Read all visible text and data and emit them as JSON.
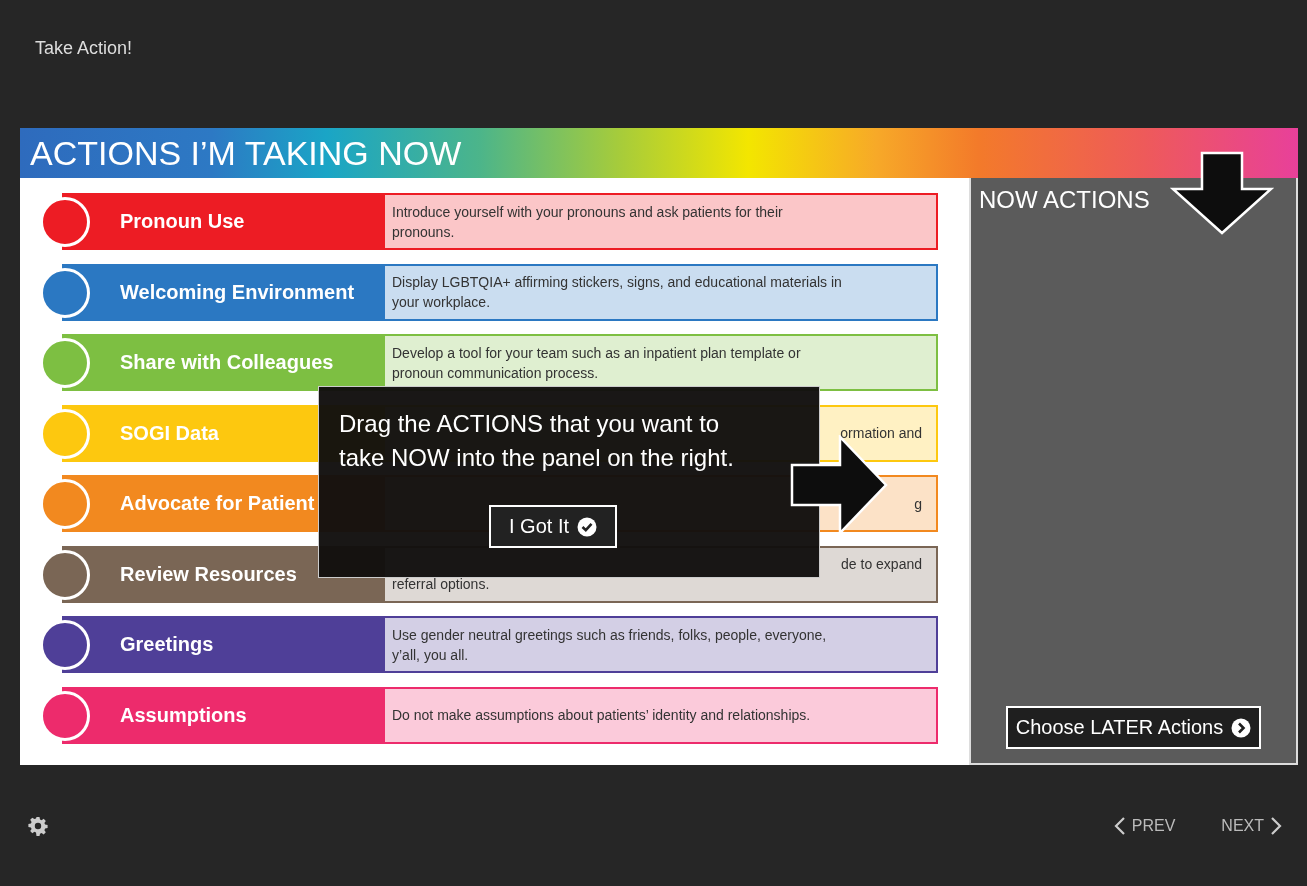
{
  "window": {
    "title": "Take Action!"
  },
  "slide": {
    "title": "ACTIONS I’M TAKING NOW",
    "actions": [
      {
        "label": "Pronoun Use",
        "color": "#ed1c24",
        "description": [
          {
            "text": "Introduce yourself with your pronouns and ask patients for their",
            "kind": "full"
          },
          {
            "text": "pronouns.",
            "kind": "full"
          }
        ]
      },
      {
        "label": "Welcoming Environment",
        "color": "#2b78c2",
        "description": [
          {
            "text": "Display LGBTQIA+ affirming stickers, signs, and educational materials in",
            "kind": "full"
          },
          {
            "text": "your workplace.",
            "kind": "full"
          }
        ]
      },
      {
        "label": "Share with Colleagues",
        "color": "#7dbf42",
        "description": [
          {
            "text": "Develop a tool for your team such as an inpatient plan template or",
            "kind": "full"
          },
          {
            "text": "pronoun communication process.",
            "kind": "full"
          }
        ]
      },
      {
        "label": "SOGI Data",
        "color": "#fdc80f",
        "description": [
          {
            "text": "ormation and",
            "kind": "partial"
          }
        ]
      },
      {
        "label": "Advocate for Patient",
        "color": "#f2891f",
        "description": [
          {
            "text": "g",
            "kind": "partial"
          }
        ]
      },
      {
        "label": "Review Resources",
        "color": "#7a6655",
        "description": [
          {
            "text": "de to expand",
            "kind": "partial"
          },
          {
            "text": "referral options.",
            "kind": "full"
          }
        ]
      },
      {
        "label": "Greetings",
        "color": "#4f3f98",
        "description": [
          {
            "text": "Use gender neutral greetings such as friends, folks, people, everyone,",
            "kind": "full"
          },
          {
            "text": "y’all, you all.",
            "kind": "full"
          }
        ]
      },
      {
        "label": "Assumptions",
        "color": "#ed2b6c",
        "description": [
          {
            "text": "Do not make assumptions about patients’ identity and relationships.",
            "kind": "full"
          }
        ]
      }
    ],
    "panel": {
      "title": "NOW ACTIONS",
      "button": "Choose LATER Actions"
    },
    "overlay": {
      "message": "Drag the ACTIONS that you want to take NOW into the panel on the right.",
      "button": "I Got It"
    }
  },
  "footer": {
    "prev": "PREV",
    "next": "NEXT"
  }
}
